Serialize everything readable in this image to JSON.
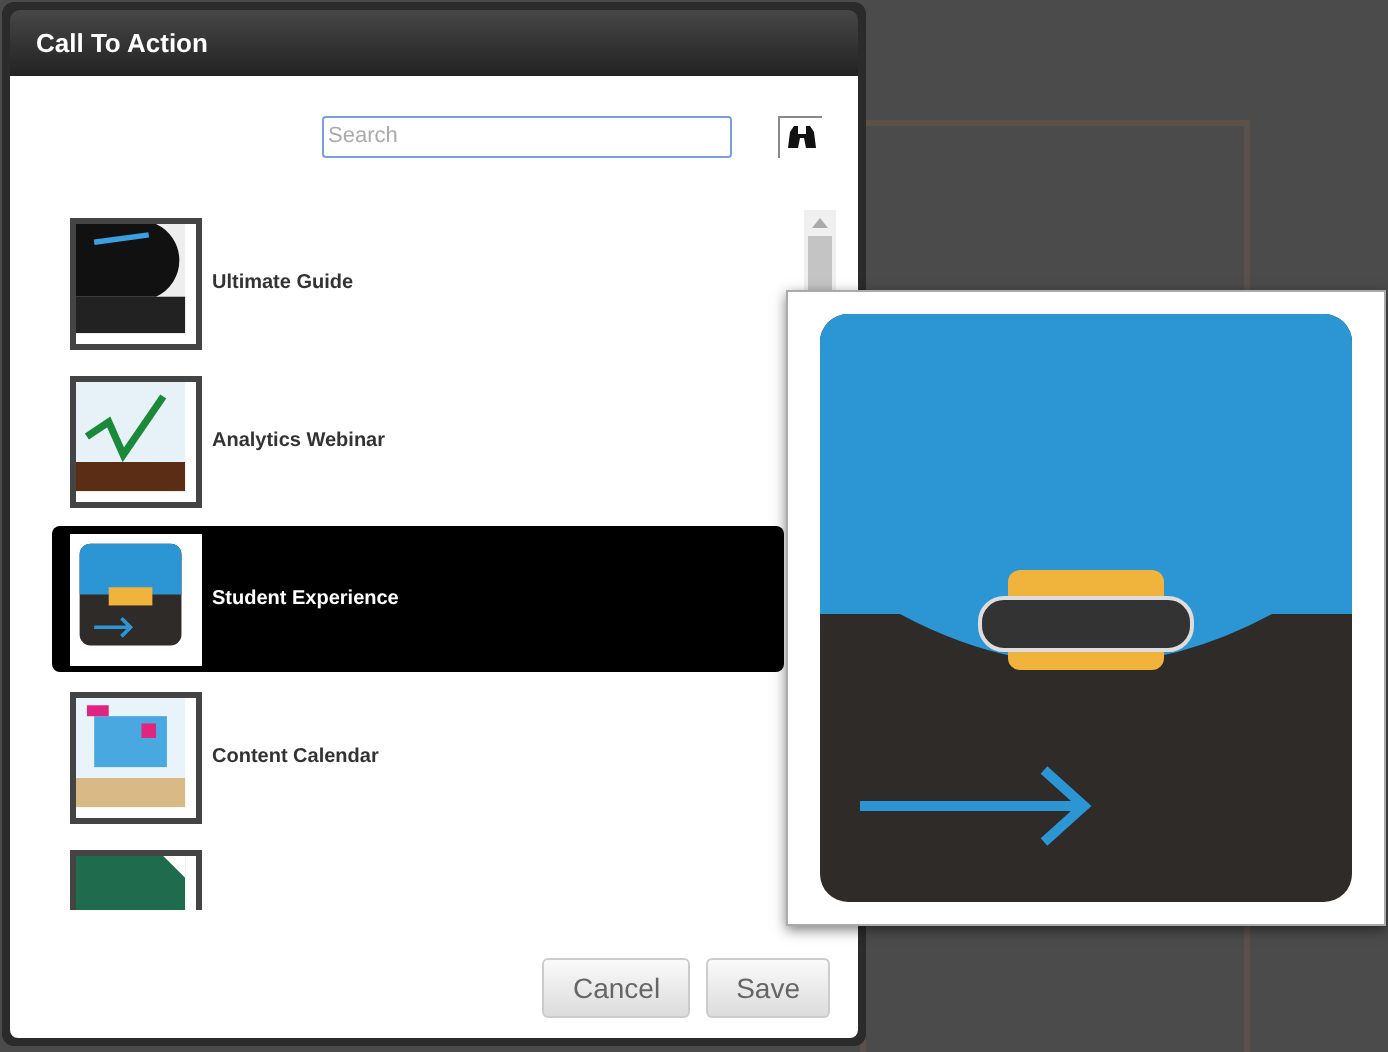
{
  "dialog": {
    "title": "Call To Action",
    "search": {
      "placeholder": "Search"
    },
    "items": [
      {
        "label": "Ultimate Guide",
        "kind": "guide",
        "selected": false
      },
      {
        "label": "Analytics Webinar",
        "kind": "chart",
        "selected": false
      },
      {
        "label": "Student Experience",
        "kind": "infographic",
        "selected": true
      },
      {
        "label": "Content Calendar",
        "kind": "calendar",
        "selected": false
      },
      {
        "kind": "green",
        "selected": false
      }
    ],
    "buttons": [
      "Cancel",
      "Save"
    ]
  }
}
